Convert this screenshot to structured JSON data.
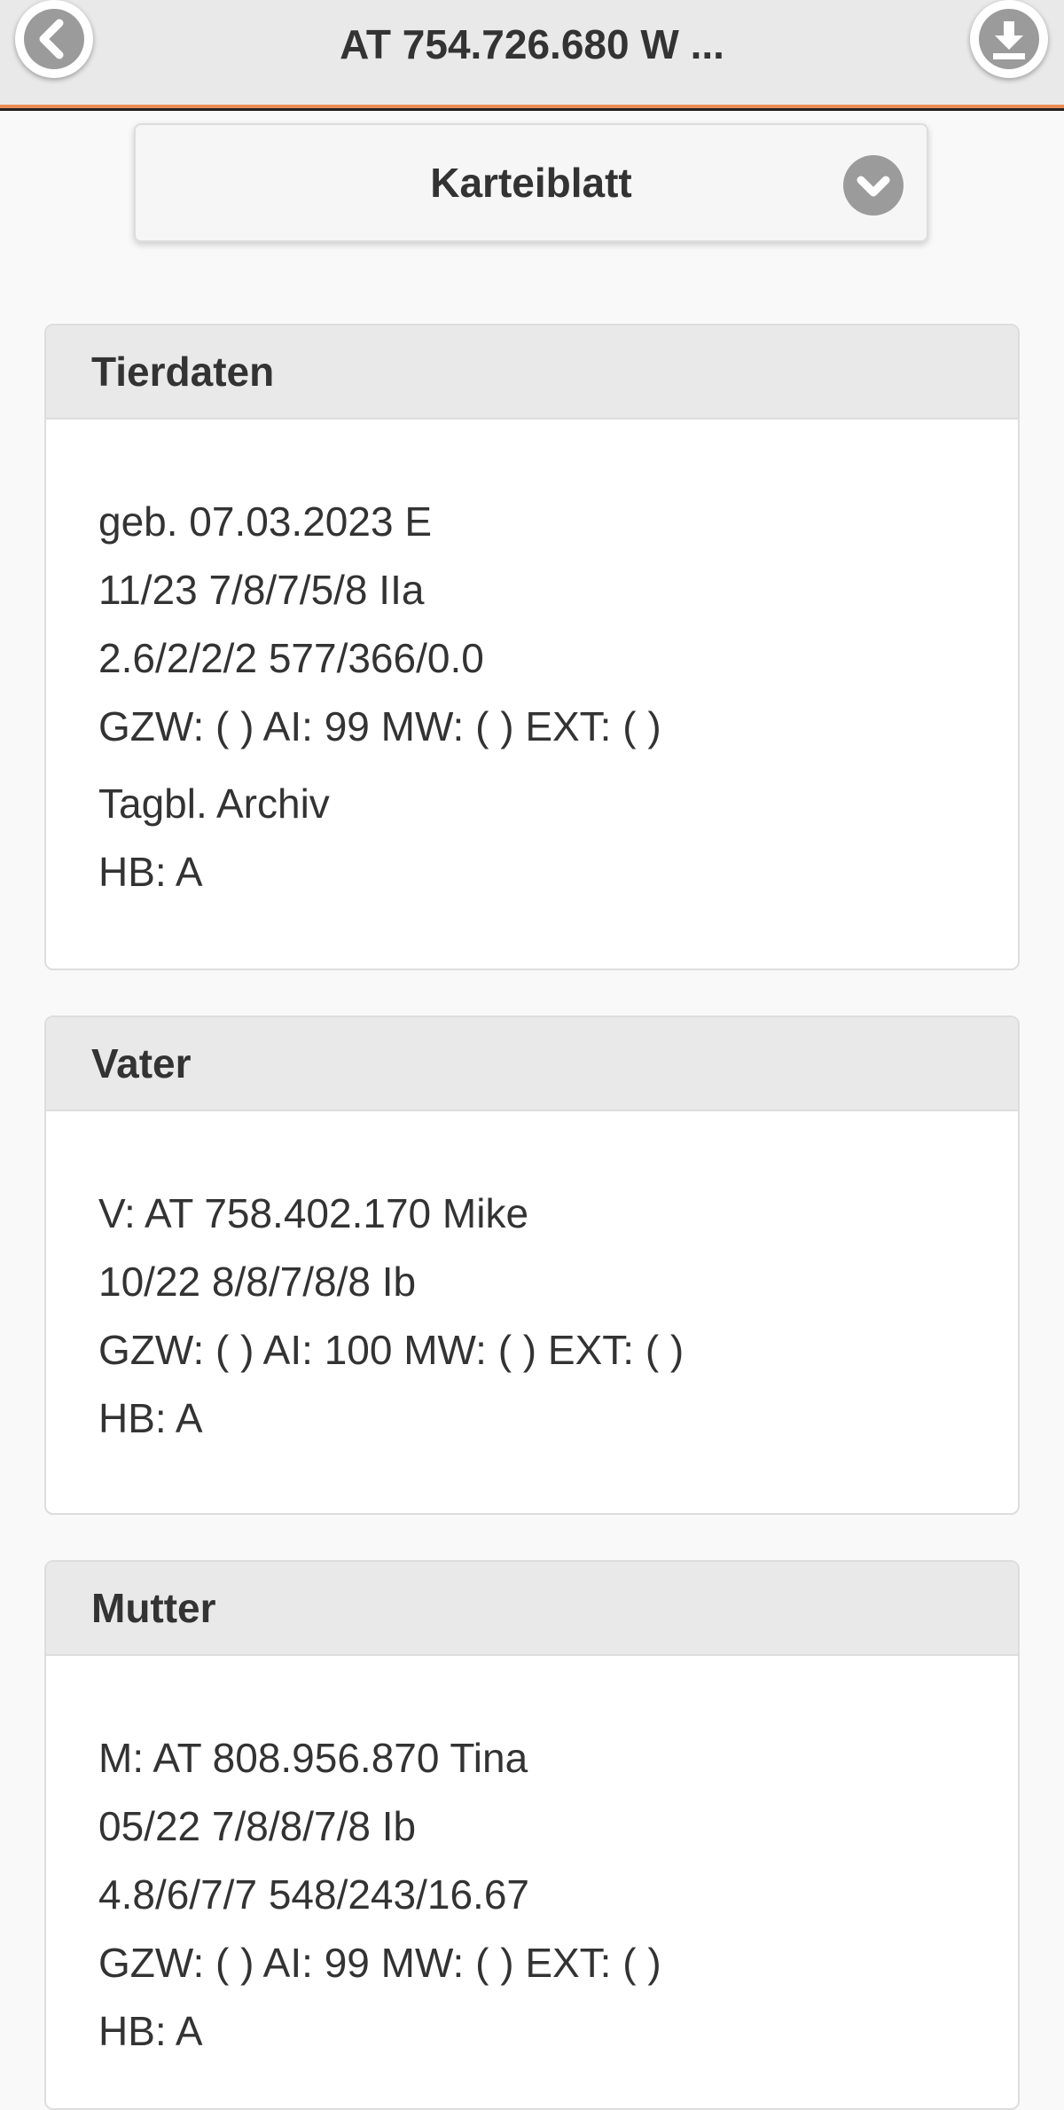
{
  "header": {
    "title": "AT 754.726.680 W ...",
    "back_icon": "chevron-left-icon",
    "download_icon": "download-icon"
  },
  "view_select": {
    "selected": "Karteiblatt",
    "icon": "chevron-down-icon"
  },
  "sections": {
    "tierdaten": {
      "title": "Tierdaten",
      "lines": [
        "geb. 07.03.2023 E",
        "11/23 7/8/7/5/8 IIa",
        "2.6/2/2/2 577/366/0.0",
        "GZW: ( ) AI: 99 MW: ( ) EXT: ( )",
        "Tagbl. Archiv",
        "HB: A"
      ]
    },
    "vater": {
      "title": "Vater",
      "lines": [
        "V: AT 758.402.170 Mike",
        "10/22 8/8/7/8/8 Ib",
        "GZW: ( ) AI: 100 MW: ( ) EXT: ( )",
        "HB: A"
      ]
    },
    "mutter": {
      "title": "Mutter",
      "lines": [
        "M: AT 808.956.870 Tina",
        "05/22 7/8/8/7/8 Ib",
        "4.8/6/7/7 548/243/16.67",
        "GZW: ( ) AI: 99 MW: ( ) EXT: ( )",
        "HB: A"
      ]
    }
  },
  "colors": {
    "accent": "#e98a52",
    "header_bg": "#e9e9e9",
    "icon_bg": "#9b9b9b",
    "text": "#333333"
  }
}
